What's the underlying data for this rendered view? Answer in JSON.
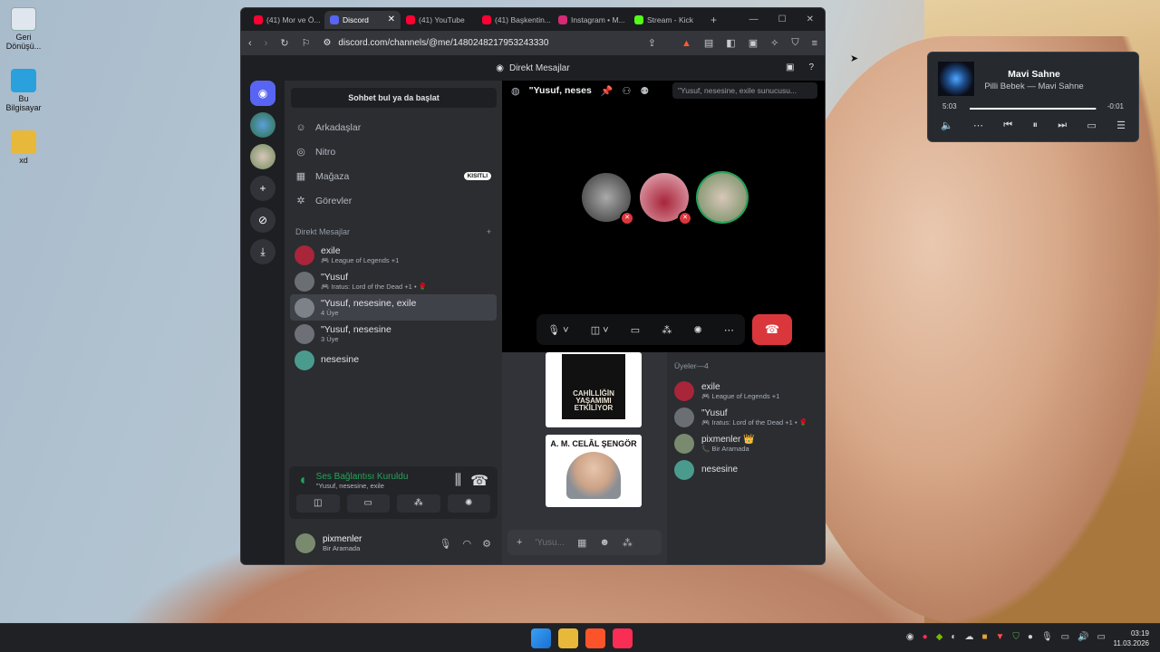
{
  "desktop": {
    "icons": [
      {
        "label": "Geri Dönüşü..."
      },
      {
        "label": "Bu Bilgisayar"
      },
      {
        "label": "xd"
      }
    ]
  },
  "browser": {
    "tabs": [
      {
        "label": "(41) Mor ve Ö...",
        "icon": "youtube-icon",
        "color": "#ff0033"
      },
      {
        "label": "Discord",
        "icon": "discord-icon",
        "color": "#5865f2"
      },
      {
        "label": "(41) YouTube",
        "icon": "youtube-icon",
        "color": "#ff0033"
      },
      {
        "label": "(41) Başkentin...",
        "icon": "youtube-icon",
        "color": "#ff0033"
      },
      {
        "label": "Instagram • M...",
        "icon": "instagram-icon",
        "color": "#d62976"
      },
      {
        "label": "Stream - Kick",
        "icon": "kick-icon",
        "color": "#53fc18"
      }
    ],
    "url": "discord.com/channels/@me/1480248217953243330"
  },
  "discord": {
    "window_title": "Direkt Mesajlar",
    "search_placeholder": "Sohbet bul ya da başlat",
    "nav": [
      {
        "label": "Arkadaşlar",
        "icon": "friends-icon"
      },
      {
        "label": "Nitro",
        "icon": "nitro-icon"
      },
      {
        "label": "Mağaza",
        "icon": "shop-icon",
        "badge": "KISITLI"
      },
      {
        "label": "Görevler",
        "icon": "quests-icon"
      }
    ],
    "dm_header": "Direkt Mesajlar",
    "dms": [
      {
        "name": "exile",
        "sub": "🎮 League of Legends +1",
        "color": "#a8253a"
      },
      {
        "name": "\"Yusuf",
        "sub": "🎮 Iratus: Lord of the Dead +1 • 🌹",
        "color": "#6b6e73"
      },
      {
        "name": "\"Yusuf, nesesine, exile",
        "sub": "4 Üye",
        "color": "#7d8188"
      },
      {
        "name": "\"Yusuf, nesesine",
        "sub": "3 Üye",
        "color": "#6d7077"
      },
      {
        "name": "nesesine",
        "sub": "",
        "color": "#4a9b8e"
      }
    ],
    "voice": {
      "status": "Ses Bağlantısı Kuruldu",
      "channel": "\"Yusuf, nesesine, exile"
    },
    "user": {
      "name": "pixmenler",
      "status": "Bir Aramada"
    },
    "channel": {
      "title": "\"Yusuf, neses",
      "search_placeholder": "\"Yusuf, nesesine, exile sunucusu..."
    },
    "messages": [
      {
        "title": "CAHİLLİĞİN YAŞAMIMI ETKİLİYOR"
      },
      {
        "title": "A. M. CELÂL ŞENGÖR"
      }
    ],
    "composer_placeholder": "'Yusu...",
    "members_header": "Üyeler—4",
    "members": [
      {
        "name": "exile",
        "sub": "🎮 League of Legends +1",
        "color": "#a8253a"
      },
      {
        "name": "\"Yusuf",
        "sub": "🎮 Iratus: Lord of the Dead +1 • 🌹",
        "color": "#6b6e73"
      },
      {
        "name": "pixmenler 👑",
        "sub": "📞 Bir Aramada",
        "color": "#7a8a6e"
      },
      {
        "name": "nesesine",
        "sub": "",
        "color": "#4a9b8e"
      }
    ]
  },
  "player": {
    "title": "Mavi Sahne",
    "subtitle": "Pilli Bebek — Mavi Sahne",
    "elapsed": "5:03",
    "remaining": "-0:01",
    "progress": 0.99
  },
  "taskbar": {
    "time": "03:19",
    "date": "11.03.2026"
  }
}
